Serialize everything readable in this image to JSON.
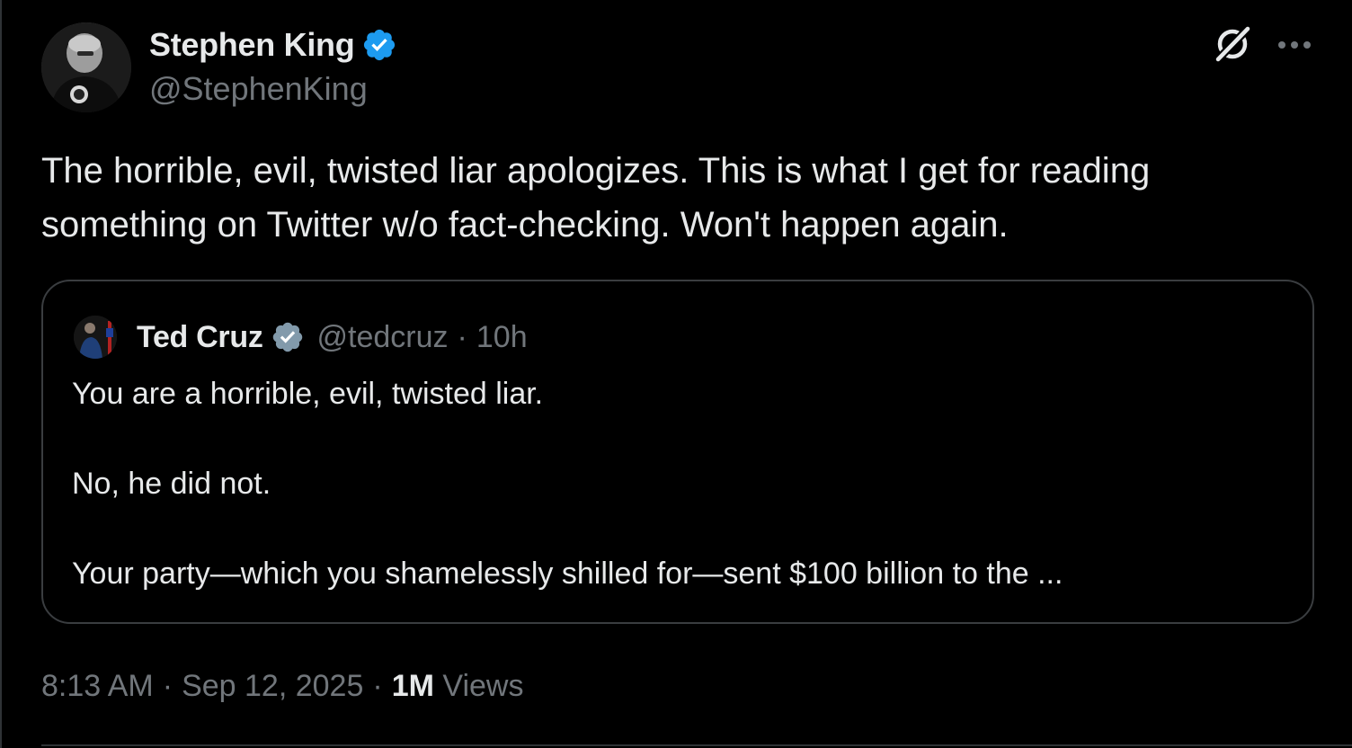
{
  "author": {
    "name": "Stephen King",
    "handle": "@StephenKing",
    "verified": true
  },
  "tweet": {
    "text": "The horrible, evil, twisted liar apologizes. This is what I get for reading something on Twitter w/o fact-checking. Won't happen again."
  },
  "quoted_tweet": {
    "name": "Ted Cruz",
    "handle": "@tedcruz",
    "separator": "·",
    "time": "10h",
    "verified_type": "gray",
    "lines": [
      "You are a horrible, evil, twisted liar.",
      "No, he did not.",
      "Your party—which you shamelessly shilled for—sent $100 billion to the ..."
    ]
  },
  "meta": {
    "time": "8:13 AM",
    "separator": "·",
    "date": "Sep 12, 2025",
    "views_count": "1M",
    "views_label": "Views"
  },
  "icons": {
    "author_verified": "verified-badge-blue-icon",
    "quote_verified": "verified-badge-gray-icon",
    "grok": "grok-icon",
    "more": "more-horizontal-icon"
  },
  "colors": {
    "background": "#000000",
    "text_primary": "#e7e9ea",
    "text_secondary": "#71767b",
    "border": "#3a3d40",
    "verified_blue": "#1d9bf0",
    "verified_gray": "#829aab"
  }
}
